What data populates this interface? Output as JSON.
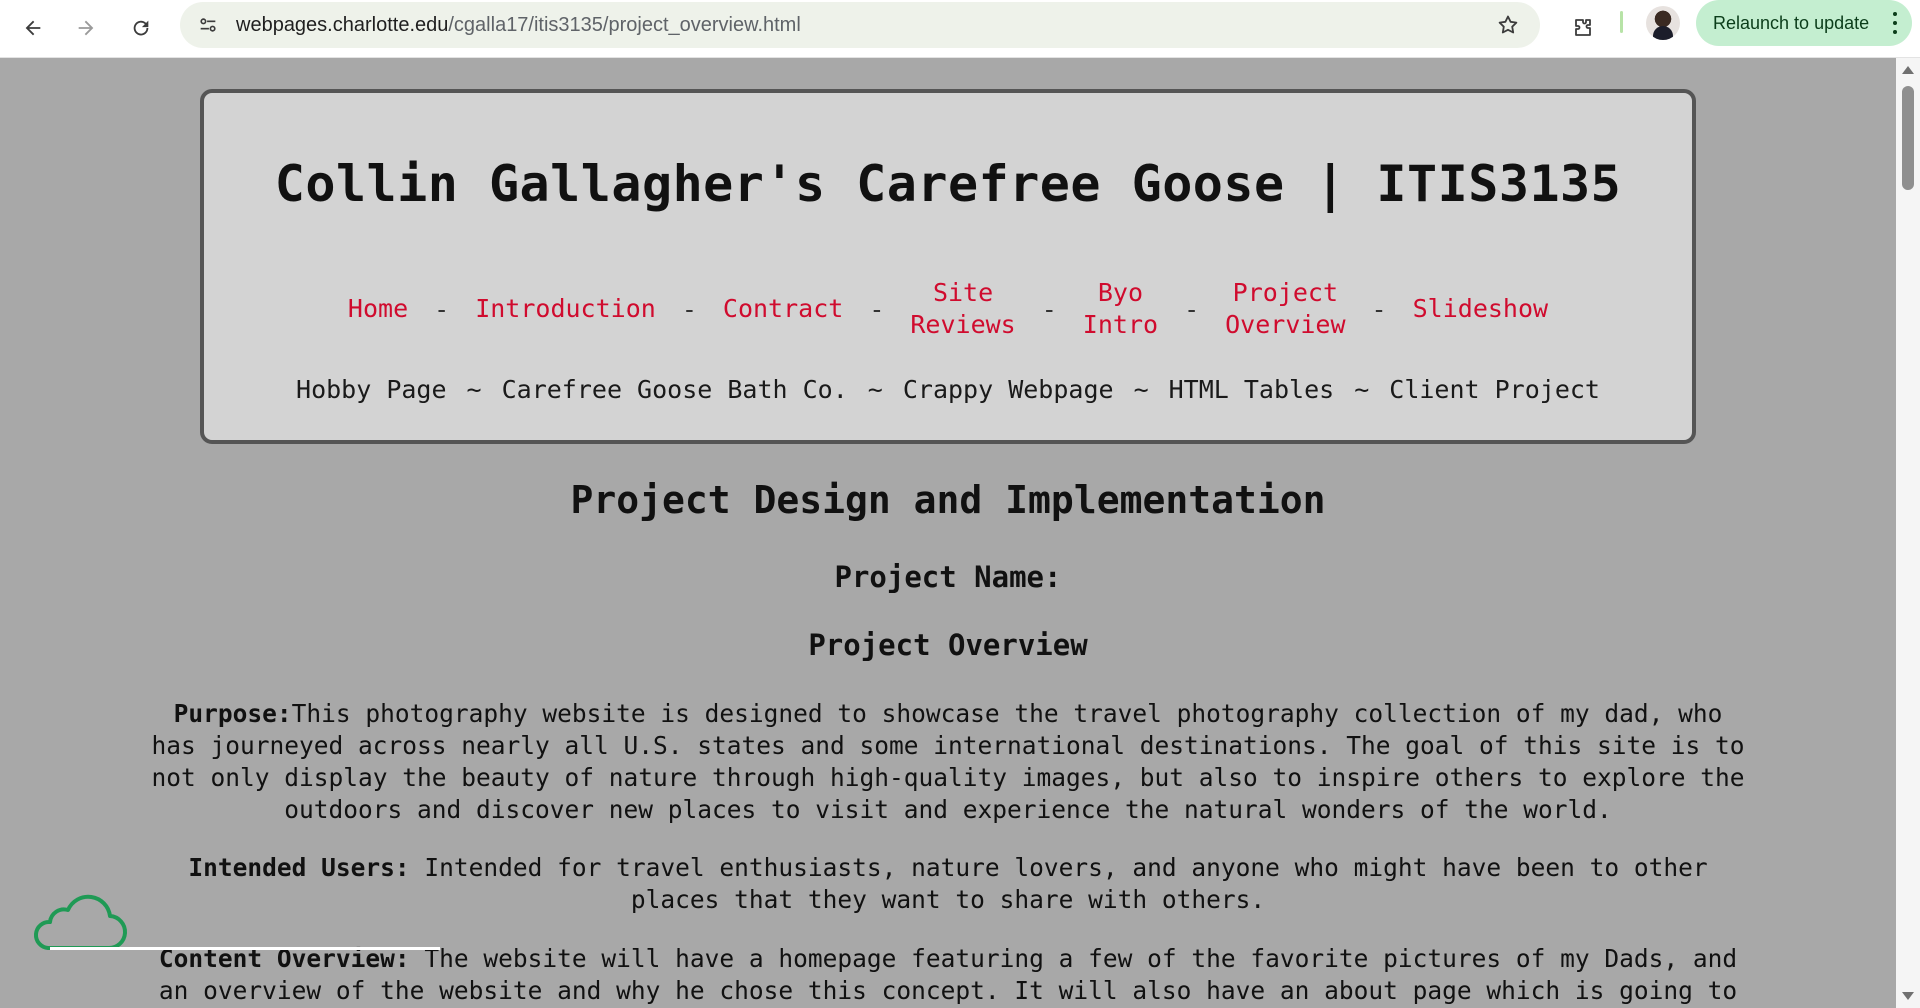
{
  "browser": {
    "url_host": "webpages.charlotte.edu",
    "url_path": "/cgalla17/itis3135/project_overview.html",
    "relaunch_label": "Relaunch to update"
  },
  "header": {
    "title": "Collin Gallagher's Carefree Goose | ITIS3135",
    "nav_primary": [
      {
        "label": "Home"
      },
      {
        "label": "Introduction"
      },
      {
        "label": "Contract"
      },
      {
        "label": "Site Reviews",
        "line1": "Site",
        "line2": "Reviews"
      },
      {
        "label": "Byo Intro",
        "line1": "Byo",
        "line2": "Intro"
      },
      {
        "label": "Project Overview",
        "line1": "Project",
        "line2": "Overview"
      },
      {
        "label": "Slideshow"
      }
    ],
    "nav_primary_separator": "-",
    "nav_secondary": [
      {
        "label": "Hobby Page"
      },
      {
        "label": "Carefree Goose Bath Co."
      },
      {
        "label": "Crappy Webpage"
      },
      {
        "label": "HTML Tables"
      },
      {
        "label": "Client Project"
      }
    ],
    "nav_secondary_separator": "~"
  },
  "main": {
    "heading": "Project Design and Implementation",
    "project_name_label": "Project Name:",
    "overview_heading": "Project Overview",
    "purpose_label": "Purpose:",
    "purpose_text": "This photography website is designed to showcase the travel photography collection of my dad, who has journeyed across nearly all U.S. states and some international destinations. The goal of this site is to not only display the beauty of nature through high-quality images, but also to inspire others to explore the outdoors and discover new places to visit and experience the natural wonders of the world.",
    "users_label": "Intended Users:",
    "users_text": " Intended for travel enthusiasts, nature lovers, and anyone who might have been to other places that they want to share with others.",
    "content_label": "Content Overview:",
    "content_text": " The website will have a homepage featuring a few of the favorite pictures of my Dads, and an overview of the website and why he chose this concept. It will also have an about page which is going to"
  },
  "colors": {
    "page_bg": "#a8a8a8",
    "header_bg": "#d3d3d3",
    "nav_link": "#d00b2e",
    "relaunch_bg": "#c4eed0"
  }
}
